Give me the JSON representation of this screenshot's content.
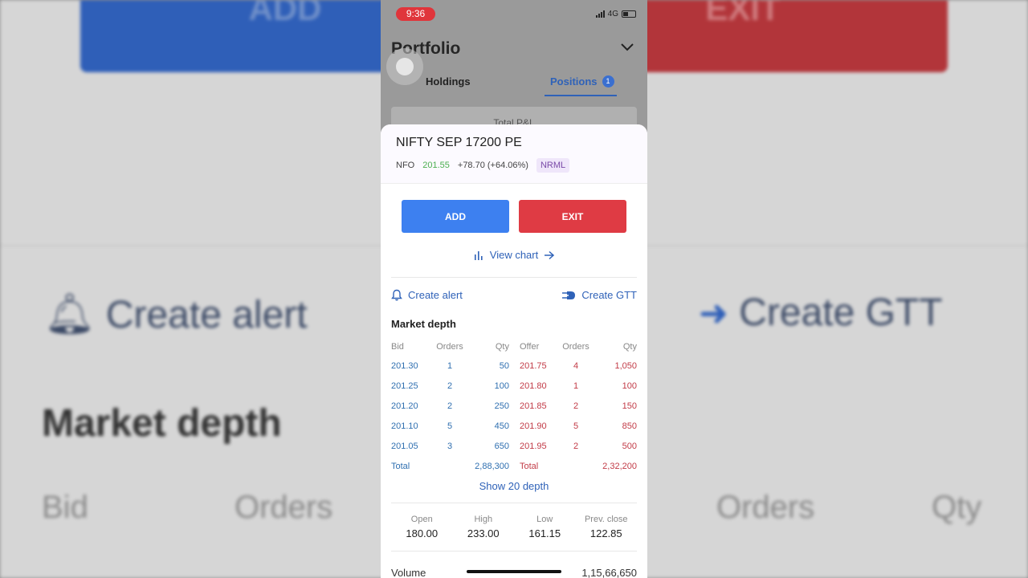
{
  "background": {
    "add_label": "ADD",
    "exit_label": "EXIT",
    "create_alert": "Create alert",
    "create_gtt": "Create GTT",
    "market_depth": "Market depth",
    "bid": "Bid",
    "orders_left": "Orders",
    "orders_right": "Orders",
    "qty": "Qty"
  },
  "status_bar": {
    "time": "9:36",
    "network": "4G"
  },
  "portfolio": {
    "title": "Portfolio",
    "tabs": [
      {
        "label": "Holdings"
      },
      {
        "label": "Positions",
        "badge": "1"
      }
    ],
    "card_label": "Total P&L"
  },
  "instrument": {
    "name": "NIFTY SEP 17200 PE",
    "exchange": "NFO",
    "ltp": "201.55",
    "change": "+78.70 (+64.06%)",
    "product": "NRML"
  },
  "actions": {
    "add": "ADD",
    "exit": "EXIT",
    "view_chart": "View chart",
    "create_alert": "Create alert",
    "create_gtt": "Create GTT"
  },
  "market_depth": {
    "title": "Market depth",
    "headers": {
      "bid": "Bid",
      "orders": "Orders",
      "qty": "Qty",
      "offer": "Offer",
      "orders2": "Orders",
      "qty2": "Qty"
    },
    "rows": [
      {
        "bid": "201.30",
        "bid_orders": "1",
        "bid_qty": "50",
        "offer": "201.75",
        "offer_orders": "4",
        "offer_qty": "1,050"
      },
      {
        "bid": "201.25",
        "bid_orders": "2",
        "bid_qty": "100",
        "offer": "201.80",
        "offer_orders": "1",
        "offer_qty": "100"
      },
      {
        "bid": "201.20",
        "bid_orders": "2",
        "bid_qty": "250",
        "offer": "201.85",
        "offer_orders": "2",
        "offer_qty": "150"
      },
      {
        "bid": "201.10",
        "bid_orders": "5",
        "bid_qty": "450",
        "offer": "201.90",
        "offer_orders": "5",
        "offer_qty": "850"
      },
      {
        "bid": "201.05",
        "bid_orders": "3",
        "bid_qty": "650",
        "offer": "201.95",
        "offer_orders": "2",
        "offer_qty": "500"
      }
    ],
    "total": {
      "bid_label": "Total",
      "bid_qty": "2,88,300",
      "offer_label": "Total",
      "offer_qty": "2,32,200"
    },
    "show_more": "Show 20 depth"
  },
  "ohlc": {
    "open_label": "Open",
    "open": "180.00",
    "high_label": "High",
    "high": "233.00",
    "low_label": "Low",
    "low": "161.15",
    "close_label": "Prev. close",
    "close": "122.85"
  },
  "volume": {
    "label": "Volume",
    "value": "1,15,66,650"
  },
  "colors": {
    "add": "#3d80f0",
    "exit": "#df3b44",
    "bid": "#2f6fb0",
    "ask": "#c23b47",
    "ltp_up": "#4caf50",
    "link": "#2f62b8"
  }
}
